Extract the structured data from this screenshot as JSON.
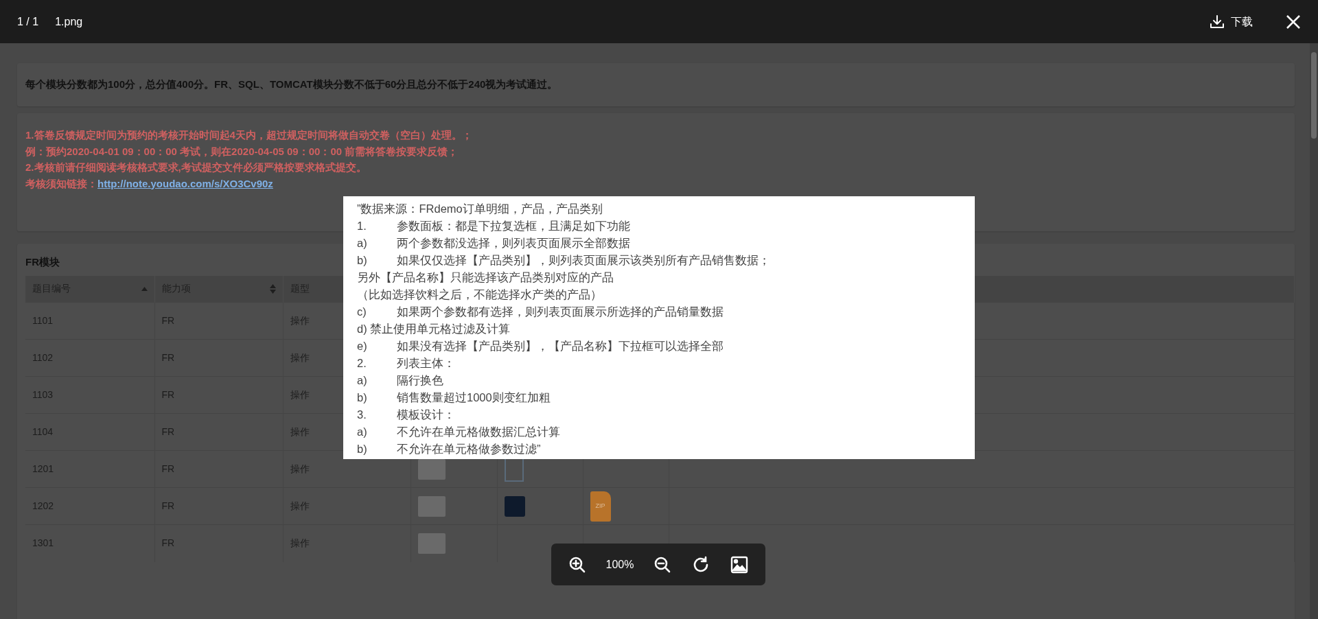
{
  "viewer": {
    "counter": "1 / 1",
    "filename": "1.png",
    "download_label": "下载",
    "zoom_label": "100%"
  },
  "notices": [
    {
      "kind": "plain",
      "lines": [
        {
          "text": "每个模块分数都为100分，总分值400分。FR、SQL、TOMCAT模块分数不低于60分且总分不低于240视为考试通过。"
        }
      ]
    },
    {
      "kind": "warning",
      "lines": [
        {
          "text": "1.答卷反馈规定时间为预约的考核开始时间起4天内，超过规定时间将做自动交卷（空白）处理。；"
        },
        {
          "text": "例：预约2020-04-01 09：00：00 考试，则在2020-04-05 09：00：00 前需将答卷按要求反馈；"
        },
        {
          "text": "2.考核前请仔细阅读考核格式要求,考试提交文件必须严格按要求格式提交。"
        },
        {
          "text": "考核须知链接：",
          "link": "http://note.youdao.com/s/XO3Cv90z"
        }
      ]
    }
  ],
  "section": {
    "title": "FR模块",
    "columns": [
      {
        "label": "题目编号",
        "sortable": true,
        "sorted": true
      },
      {
        "label": "能力项",
        "sortable": true,
        "sorted": false
      },
      {
        "label": "题型",
        "sortable": false
      }
    ],
    "rows": [
      {
        "cells": [
          "1101",
          "FR",
          "操作"
        ],
        "attachments": []
      },
      {
        "cells": [
          "1102",
          "FR",
          "操作"
        ],
        "attachments": []
      },
      {
        "cells": [
          "1103",
          "FR",
          "操作"
        ],
        "attachments": []
      },
      {
        "cells": [
          "1104",
          "FR",
          "操作"
        ],
        "attachments": []
      },
      {
        "cells": [
          "1201",
          "FR",
          "操作"
        ],
        "attachments": [
          {
            "kind": "light-thumb"
          },
          {
            "kind": "diagram-thumb"
          },
          {
            "kind": "none"
          }
        ]
      },
      {
        "cells": [
          "1202",
          "FR",
          "操作"
        ],
        "attachments": [
          {
            "kind": "light-thumb"
          },
          {
            "kind": "dark-thumb"
          },
          {
            "kind": "file",
            "label": "ZIP",
            "color": "#b8732a"
          }
        ]
      },
      {
        "cells": [
          "1301",
          "FR",
          "操作"
        ],
        "attachments": [
          {
            "kind": "light-thumb"
          },
          {
            "kind": "none"
          },
          {
            "kind": "none"
          }
        ]
      }
    ]
  },
  "image": {
    "lines": [
      {
        "text": "”数据来源：FRdemo订单明细，产品，产品类别"
      },
      {
        "marker": "1.",
        "text": "参数面板：都是下拉复选框，且满足如下功能"
      },
      {
        "marker": "a)",
        "text": "两个参数都没选择，则列表页面展示全部数据"
      },
      {
        "marker": "b)",
        "text": "如果仅仅选择【产品类别】，则列表页面展示该类别所有产品销售数据；"
      },
      {
        "text": "另外【产品名称】只能选择该产品类别对应的产品"
      },
      {
        "text": "（比如选择饮料之后，不能选择水产类的产品）"
      },
      {
        "marker": "c)",
        "text": "如果两个参数都有选择，则列表页面展示所选择的产品销量数据"
      },
      {
        "text": "d) 禁止使用单元格过滤及计算"
      },
      {
        "marker": "e)",
        "text": "如果没有选择【产品类别】，【产品名称】下拉框可以选择全部"
      },
      {
        "marker": "2.",
        "text": "列表主体："
      },
      {
        "marker": "a)",
        "text": "隔行换色"
      },
      {
        "marker": "b)",
        "text": "销售数量超过1000则变红加粗"
      },
      {
        "marker": "3.",
        "text": "模板设计："
      },
      {
        "marker": "a)",
        "text": "不允许在单元格做数据汇总计算"
      },
      {
        "marker": "b)",
        "text": "不允许在单元格做参数过滤”"
      }
    ]
  }
}
